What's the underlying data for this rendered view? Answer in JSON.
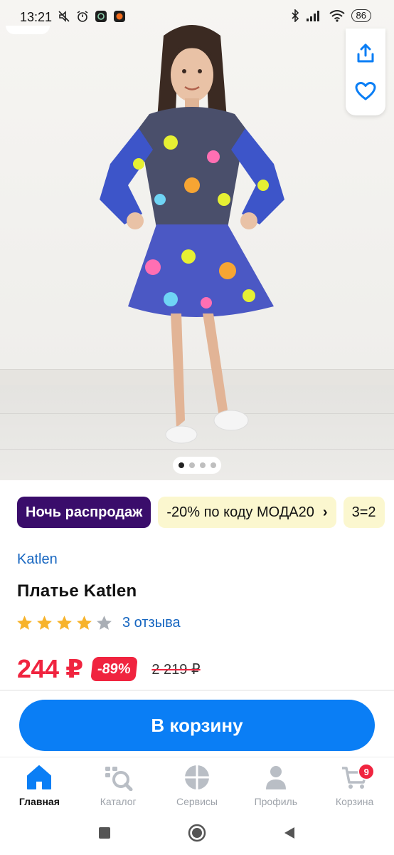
{
  "status_bar": {
    "time": "13:21",
    "battery": "86",
    "icons": [
      "muted-icon",
      "alarm-icon",
      "app-icon",
      "app-icon",
      "bluetooth-icon",
      "signal-icon",
      "wifi-icon"
    ]
  },
  "gallery": {
    "image_description_icon": "girl-in-dress-photo",
    "dots_total": 4,
    "dots_active_index": 0,
    "share_icon": "share-icon",
    "favorite_icon": "heart-icon"
  },
  "promos": [
    {
      "label": "Ночь распродаж",
      "style": "primary"
    },
    {
      "label": "-20% по коду МОДА20",
      "style": "promo",
      "chevron": "›"
    },
    {
      "label": "3=2",
      "style": "promo"
    }
  ],
  "product": {
    "brand": "Katlen",
    "title": "Платье Katlen",
    "rating_value": 4,
    "rating_max": 5,
    "reviews": "3 отзыва",
    "price": "244 ₽",
    "discount": "-89%",
    "old_price": "2 219 ₽"
  },
  "actions": {
    "add_to_cart": "В корзину"
  },
  "tabbar": {
    "items": [
      {
        "label": "Главная",
        "icon": "home-icon",
        "active": true
      },
      {
        "label": "Каталог",
        "icon": "catalog-search-icon",
        "active": false
      },
      {
        "label": "Сервисы",
        "icon": "services-icon",
        "active": false
      },
      {
        "label": "Профиль",
        "icon": "profile-icon",
        "active": false
      },
      {
        "label": "Корзина",
        "icon": "cart-icon",
        "active": false,
        "badge": "9"
      }
    ]
  },
  "colors": {
    "accent_blue": "#0a7ef5",
    "link_blue": "#1565c0",
    "price_red": "#f0243f",
    "primary_chip": "#3a0d6b",
    "promo_chip": "#fbf7cf",
    "star": "#f7b32b"
  }
}
